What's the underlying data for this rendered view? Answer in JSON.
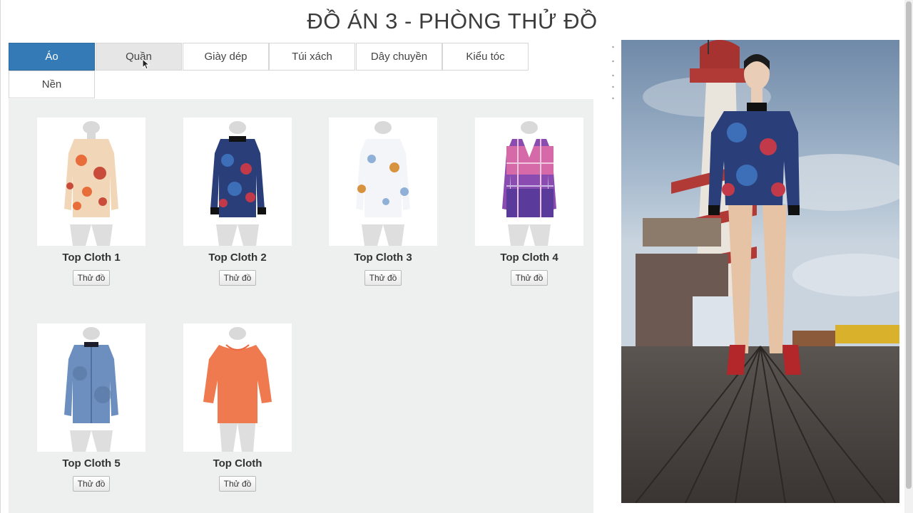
{
  "page": {
    "title": "ĐỒ ÁN 3 - PHÒNG THỬ ĐỒ"
  },
  "tabs": [
    {
      "label": "Áo",
      "state": "active"
    },
    {
      "label": "Quần",
      "state": "hover"
    },
    {
      "label": "Giày dép"
    },
    {
      "label": "Túi xách"
    },
    {
      "label": "Dây chuyền"
    },
    {
      "label": "Kiểu tóc"
    },
    {
      "label": "Nền"
    }
  ],
  "products": [
    {
      "name": "Top Cloth 1",
      "button": "Thử đồ",
      "icon": "floral-blouse-icon",
      "colors": [
        "#f2d6b8",
        "#e86d3b",
        "#c94b3a"
      ]
    },
    {
      "name": "Top Cloth 2",
      "button": "Thử đồ",
      "icon": "dark-floral-blouse-icon",
      "colors": [
        "#2a3f7a",
        "#3d6fb8",
        "#c23a4a"
      ]
    },
    {
      "name": "Top Cloth 3",
      "button": "Thử đồ",
      "icon": "white-floral-blouse-icon",
      "colors": [
        "#f3f5f8",
        "#8fb1d8",
        "#d8933f"
      ]
    },
    {
      "name": "Top Cloth 4",
      "button": "Thử đồ",
      "icon": "plaid-shirt-icon",
      "colors": [
        "#d66aa8",
        "#8a4cb0",
        "#5a3b9c"
      ]
    },
    {
      "name": "Top Cloth 5",
      "button": "Thử đồ",
      "icon": "denim-shirt-icon",
      "colors": [
        "#6c8fbf",
        "#52709b",
        "#1d1d2a"
      ]
    },
    {
      "name": "Top Cloth",
      "button": "Thử đồ",
      "icon": "orange-top-icon",
      "colors": [
        "#f07a4f",
        "#e8673e",
        "#f29a74"
      ]
    }
  ],
  "colors": {
    "active_tab": "#337ab7",
    "panel_bg": "#eef0f0",
    "mannequin": "#d9d9d9"
  },
  "preview": {
    "icon": "fitting-room-preview-icon",
    "background_icon": "pier-helter-skelter-scene-icon",
    "model_top_colors": [
      "#2a3f7a",
      "#3d6fb8",
      "#c23a4a"
    ],
    "shoe_color": "#b3262a"
  }
}
